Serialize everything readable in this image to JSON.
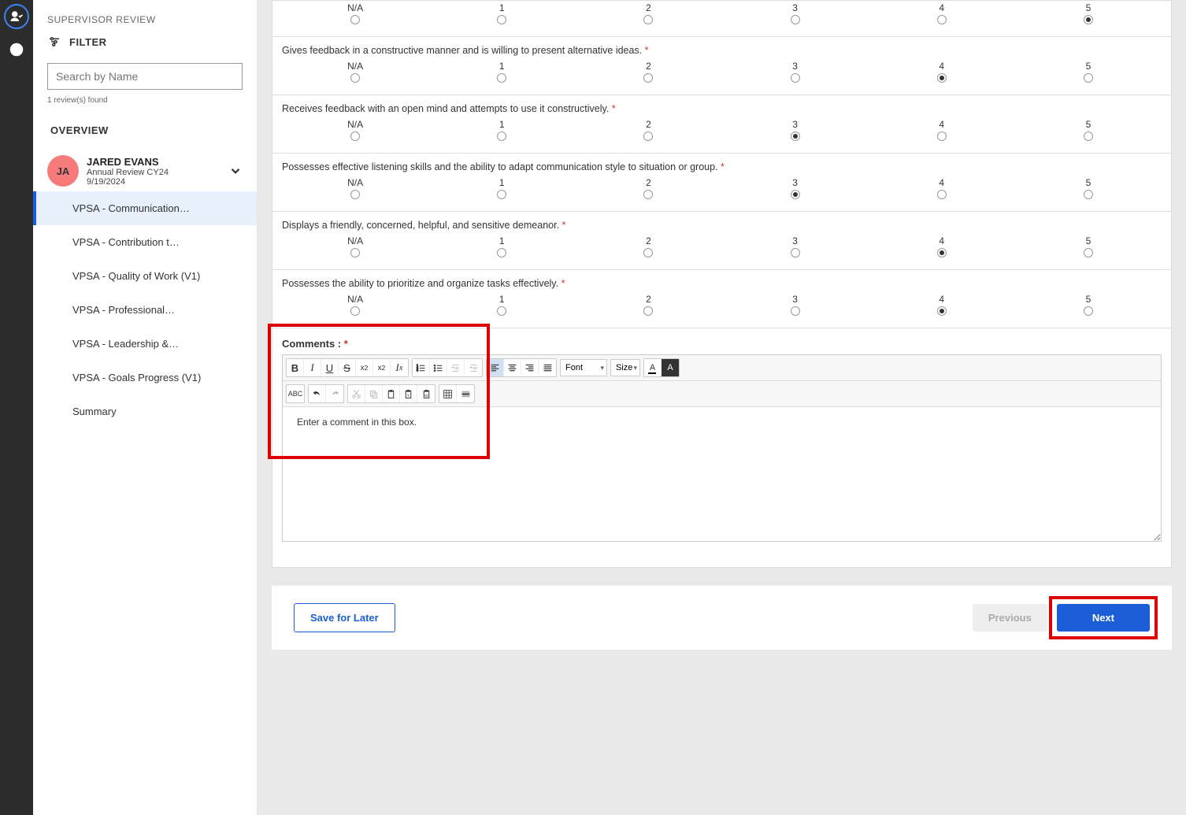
{
  "leftbar": {
    "icon1": "user-check-icon",
    "icon2": "list-icon"
  },
  "sidebar": {
    "header": "SUPERVISOR REVIEW",
    "filter_label": "FILTER",
    "search_placeholder": "Search by Name",
    "found_text": "1 review(s) found",
    "overview_label": "OVERVIEW",
    "person": {
      "initials": "JA",
      "name": "JARED EVANS",
      "subtitle": "Annual Review CY24",
      "date": "9/19/2024"
    },
    "nav": [
      "VPSA - Communication…",
      "VPSA - Contribution t…",
      "VPSA - Quality of Work (V1)",
      "VPSA - Professional…",
      "VPSA - Leadership &…",
      "VPSA - Goals Progress (V1)",
      "Summary"
    ]
  },
  "rating_options": [
    "N/A",
    "1",
    "2",
    "3",
    "4",
    "5"
  ],
  "questions": [
    {
      "text": "",
      "selected": 5,
      "header_only_ratings": true
    },
    {
      "text": "Gives feedback in a constructive manner and is willing to present alternative ideas.",
      "selected": 4
    },
    {
      "text": "Receives feedback with an open mind and attempts to use it constructively.",
      "selected": 3
    },
    {
      "text": "Possesses effective listening skills and the ability to adapt communication style to situation or group.",
      "selected": 3
    },
    {
      "text": "Displays a friendly, concerned, helpful, and sensitive demeanor.",
      "selected": 4
    },
    {
      "text": "Possesses the ability to prioritize and organize tasks effectively.",
      "selected": 4
    }
  ],
  "comments": {
    "label": "Comments :",
    "placeholder": "Enter a comment in this box.",
    "font_label": "Font",
    "size_label": "Size",
    "btn_A": "A"
  },
  "footer": {
    "save": "Save for Later",
    "previous": "Previous",
    "next": "Next"
  }
}
